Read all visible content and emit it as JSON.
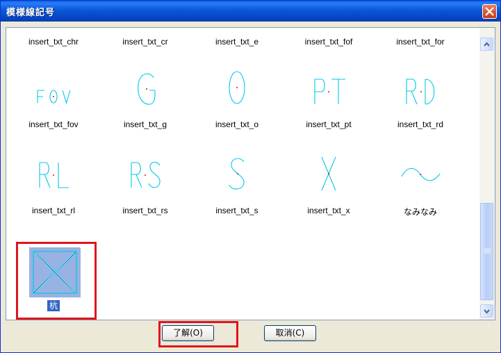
{
  "window": {
    "title": "模様線記号"
  },
  "palette": {
    "glyph_color": "#00c8e6",
    "accent": "#e0141b",
    "selection": "#3165c5"
  },
  "top_row_labels": [
    "insert_txt_chr",
    "insert_txt_cr",
    "insert_txt_e",
    "insert_txt_fof",
    "insert_txt_for"
  ],
  "rows": [
    {
      "items": [
        {
          "label": "insert_txt_fov",
          "glyph": "F O V"
        },
        {
          "label": "insert_txt_g",
          "glyph": "G"
        },
        {
          "label": "insert_txt_o",
          "glyph": "O"
        },
        {
          "label": "insert_txt_pt",
          "glyph": "PT"
        },
        {
          "label": "insert_txt_rd",
          "glyph": "R D"
        }
      ]
    },
    {
      "items": [
        {
          "label": "insert_txt_rl",
          "glyph": "R L"
        },
        {
          "label": "insert_txt_rs",
          "glyph": "R S"
        },
        {
          "label": "insert_txt_s",
          "glyph": "S"
        },
        {
          "label": "insert_txt_x",
          "glyph": "X"
        },
        {
          "label": "なみなみ",
          "glyph": "wave"
        }
      ]
    }
  ],
  "selected_item": {
    "label": "杭",
    "glyph": "boxed-x"
  },
  "buttons": {
    "ok": "了解(O)",
    "cancel": "取消(C)"
  }
}
